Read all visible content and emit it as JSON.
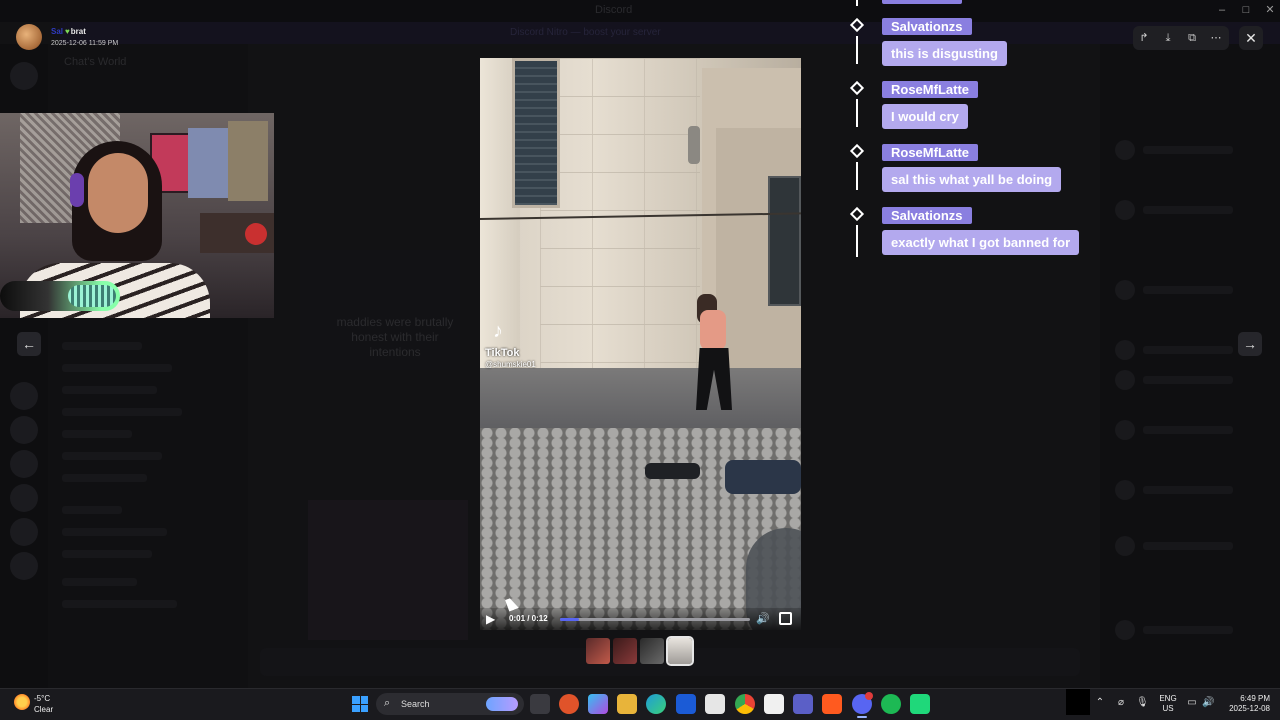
{
  "background": {
    "window_title": "Discord",
    "server_name": "Chat's World",
    "chat_caption": "maddies were brutally honest with their intentions",
    "banner_text": "Discord Nitro — boost your server"
  },
  "uploader": {
    "name": "Sal",
    "tag": "brat",
    "timestamp": "2025-12-06 11:59 PM"
  },
  "video": {
    "watermark": "TikTok",
    "handle": "@shumskie01",
    "time": "0:01 / 0:12",
    "progress": 0.1
  },
  "chat": [
    {
      "user": "Salvationzs",
      "message": "this is disgusting"
    },
    {
      "user": "RoseMfLatte",
      "message": "I would cry"
    },
    {
      "user": "RoseMfLatte",
      "message": "sal this what yall be doing"
    },
    {
      "user": "Salvationzs",
      "message": "exactly what I got banned for"
    }
  ],
  "taskbar": {
    "weather_temp": "-5°C",
    "weather_cond": "Clear",
    "search_label": "Search",
    "lang_top": "ENG",
    "lang_bottom": "US",
    "clock_time": "6:49 PM",
    "clock_date": "2025-12-08"
  },
  "colors": {
    "chat_user_bg": "#8a7fe0",
    "chat_msg_bg": "#b3a9ee",
    "progress": "#5865f2",
    "start": "#3aa0ff"
  }
}
